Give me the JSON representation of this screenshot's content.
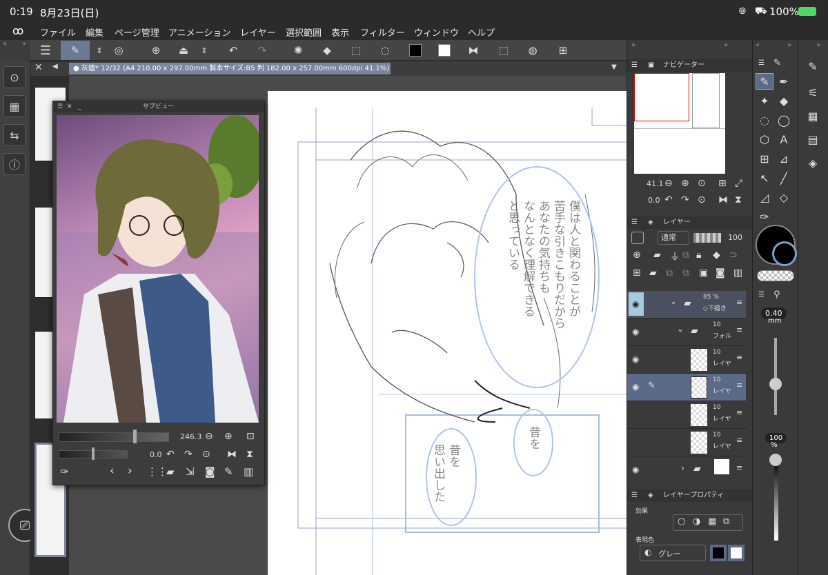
{
  "status": {
    "time": "0:19",
    "date": "8月23日(日)",
    "battery": "100%"
  },
  "menu": [
    "ファイル",
    "編集",
    "ページ管理",
    "アニメーション",
    "レイヤー",
    "選択範囲",
    "表示",
    "フィルター",
    "ウィンドウ",
    "ヘルプ"
  ],
  "doc_tab": "● 灰燼* 12/32 (A4 210.00 x 297.00mm 製本サイズ:B5 判 182.00 x 257.00mm 600dpi 41.1%)",
  "subview": {
    "title": "サブビュー",
    "zoom": "246.3",
    "rotation": "0.0"
  },
  "navigator": {
    "title": "ナビゲーター",
    "zoom": "41.1",
    "rotation": "0.0"
  },
  "layers": {
    "title": "レイヤー",
    "blend_mode": "通常",
    "opacity": "100",
    "rows": [
      {
        "pct": "85 %",
        "name": "◇下描き",
        "type": "folder"
      },
      {
        "pct": "10",
        "name": "フォル",
        "type": "folder"
      },
      {
        "pct": "10",
        "name": "レイヤ",
        "type": "layer"
      },
      {
        "pct": "10",
        "name": "レイヤ",
        "type": "layer"
      },
      {
        "pct": "10",
        "name": "レイヤ",
        "type": "layer"
      },
      {
        "pct": "10",
        "name": "レイヤ",
        "type": "layer"
      },
      {
        "pct": "",
        "name": "",
        "type": "folder"
      }
    ]
  },
  "layer_property": {
    "title": "レイヤープロパティ",
    "effect_label": "効果",
    "color_label": "表現色",
    "color_value": "グレー"
  },
  "brush": {
    "size": "0.40",
    "unit": "mm",
    "opacity_pct": "100",
    "opacity_unit": "%"
  },
  "canvas_text": {
    "col1": "僕は人と関わることが",
    "col2": "苦手な引きこもりだから",
    "col3": "あなたの気持ちも",
    "col4": "なんとなく理解できる",
    "col5": "と思っている",
    "bubble1": "昔を",
    "bubble2a": "昔を",
    "bubble2b": "思い出した"
  },
  "colors": {
    "accent": "#7a849a",
    "selected_layer": "#5a6a88",
    "bg": "#3a3a3a"
  }
}
